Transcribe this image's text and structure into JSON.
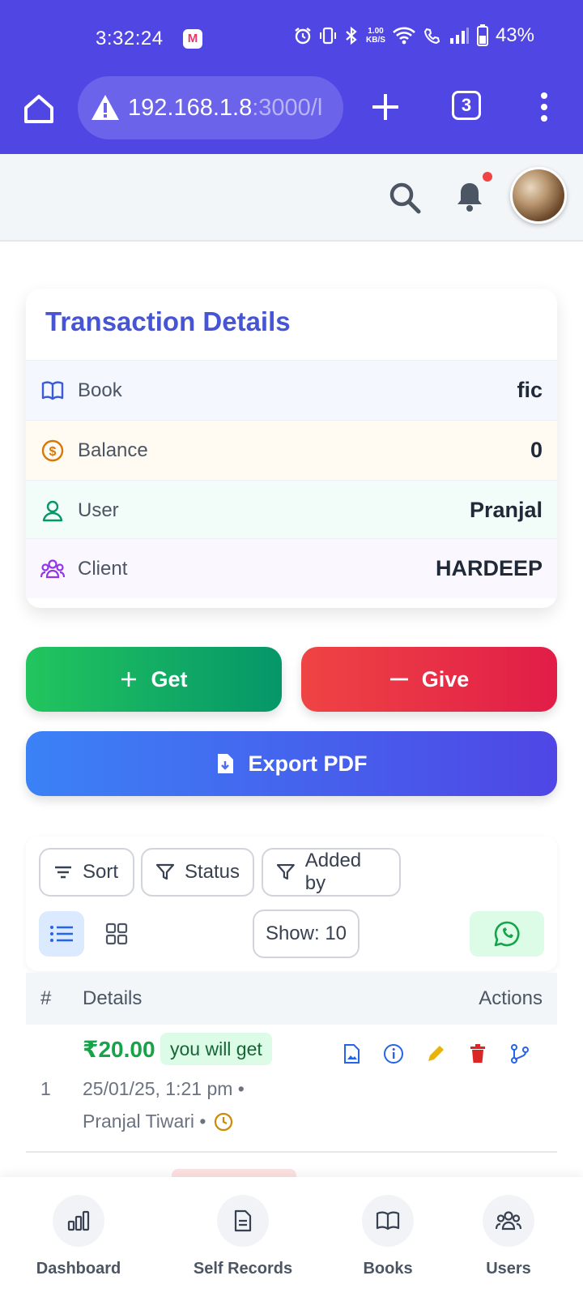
{
  "status_bar": {
    "time": "3:32:24",
    "app_icon": "M",
    "net_speed_top": "1.00",
    "net_speed_bottom": "KB/S",
    "battery": "43%"
  },
  "browser": {
    "url_main": "192.168.1.8",
    "url_dim": ":3000/l",
    "tab_count": "3"
  },
  "card": {
    "title": "Transaction Details",
    "rows": [
      {
        "label": "Book",
        "value": "fic",
        "icon": "book-icon",
        "bg": "#f4f7fd"
      },
      {
        "label": "Balance",
        "value": "0",
        "icon": "dollar-icon",
        "bg": "#fffbf3"
      },
      {
        "label": "User",
        "value": "Pranjal",
        "icon": "user-icon",
        "bg": "#f2fcf8"
      },
      {
        "label": "Client",
        "value": "HARDEEP",
        "icon": "users-icon",
        "bg": "#faf7fe"
      }
    ]
  },
  "actions": {
    "get_label": "Get",
    "give_label": "Give",
    "export_label": "Export PDF"
  },
  "filters": {
    "sort_label": "Sort",
    "status_label": "Status",
    "added_by_label": "Added by",
    "show_label": "Show: 10"
  },
  "table": {
    "headers": {
      "index": "#",
      "details": "Details",
      "actions": "Actions"
    },
    "rows": [
      {
        "index": "1",
        "amount": "₹20.00",
        "badge": "you will get",
        "date": "25/01/25, 1:21 pm •",
        "added_by": "Pranjal Tiwari •"
      }
    ]
  },
  "bottom_nav": [
    {
      "label": "Dashboard",
      "icon": "bar-chart-icon"
    },
    {
      "label": "Self Records",
      "icon": "document-icon"
    },
    {
      "label": "Books",
      "icon": "book-icon"
    },
    {
      "label": "Users",
      "icon": "users-icon"
    }
  ],
  "colors": {
    "brand": "#5046e4",
    "title": "#4655d6",
    "get": "#16a34a",
    "give": "#ef4444"
  }
}
